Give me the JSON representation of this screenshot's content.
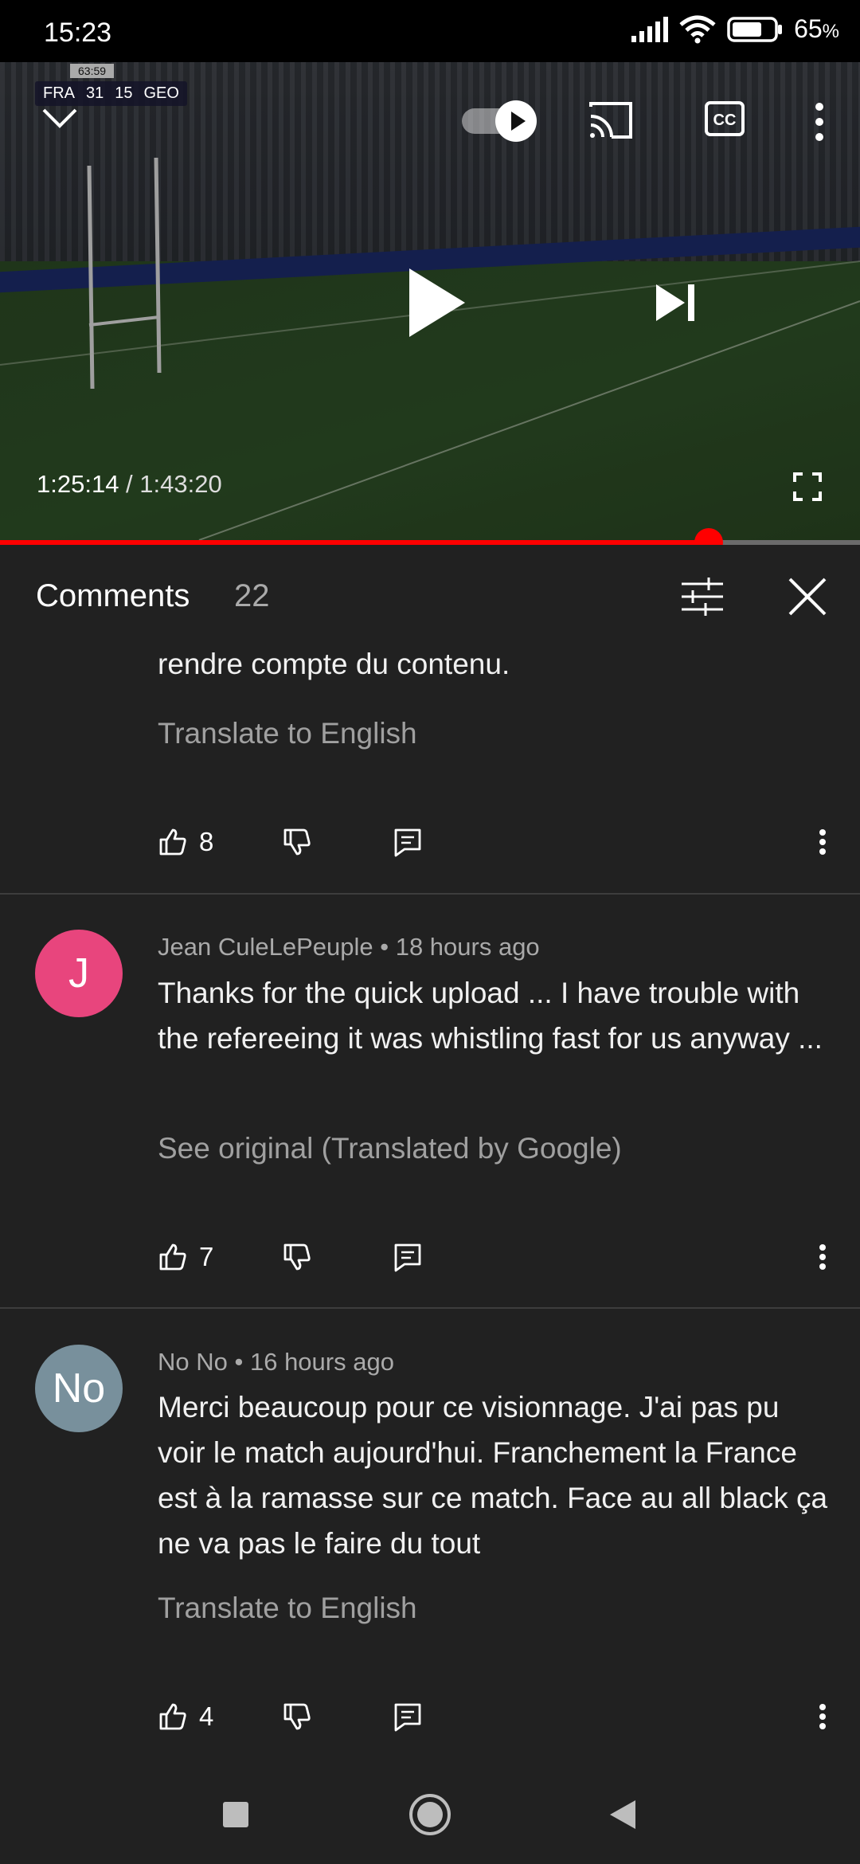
{
  "status_bar": {
    "time": "15:23",
    "battery": "65",
    "battery_unit": "%"
  },
  "video": {
    "scoreboard": {
      "clock": "63:59",
      "home": "FRA",
      "home_score": "31",
      "away_score": "15",
      "away": "GEO"
    },
    "current_time": "1:25:14",
    "separator": " / ",
    "duration": "1:43:20",
    "progress_fraction": 0.824
  },
  "comments_panel": {
    "title": "Comments",
    "count": "22"
  },
  "comments": [
    {
      "partial_text": "rendre compte du contenu.",
      "translate_label": "Translate to English",
      "likes": "8"
    },
    {
      "avatar_letter": "J",
      "avatar_color": "#e8457d",
      "author": "Jean CuleLePeuple",
      "time": "18 hours ago",
      "text": "Thanks for the quick upload ... I have trouble with the refereeing it was whistling fast for us anyway ...",
      "translate_label": "See original (Translated by Google)",
      "likes": "7"
    },
    {
      "avatar_letter": "No",
      "avatar_color": "#78909c",
      "author": "No No",
      "time": "16 hours ago",
      "text": "Merci beaucoup pour ce visionnage. J'ai pas pu voir le match aujourd'hui. Franchement la France est à la ramasse sur ce match. Face au all black ça ne va pas le faire du tout",
      "translate_label": "Translate to English",
      "likes": "4"
    }
  ],
  "meta_separator": " • "
}
